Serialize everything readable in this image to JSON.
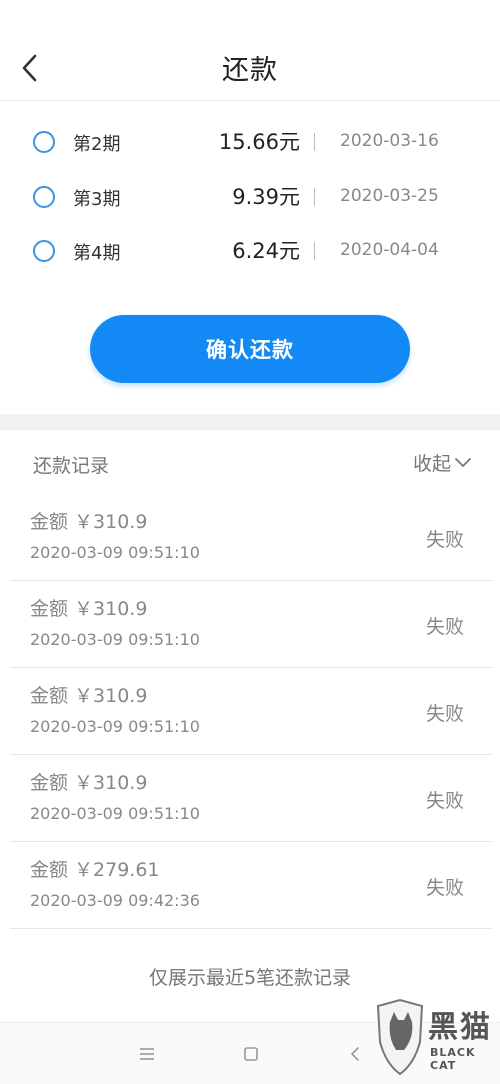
{
  "header": {
    "title": "还款"
  },
  "periods": [
    {
      "label": "第2期",
      "amount": "15.66元",
      "date": "2020-03-16"
    },
    {
      "label": "第3期",
      "amount": "9.39元",
      "date": "2020-03-25"
    },
    {
      "label": "第4期",
      "amount": "6.24元",
      "date": "2020-04-04"
    }
  ],
  "confirm_label": "确认还款",
  "records": {
    "title": "还款记录",
    "toggle_label": "收起",
    "items": [
      {
        "amount": "金额 ￥310.9",
        "time": "2020-03-09 09:51:10",
        "status": "失败"
      },
      {
        "amount": "金额 ￥310.9",
        "time": "2020-03-09 09:51:10",
        "status": "失败"
      },
      {
        "amount": "金额 ￥310.9",
        "time": "2020-03-09 09:51:10",
        "status": "失败"
      },
      {
        "amount": "金额 ￥310.9",
        "time": "2020-03-09 09:51:10",
        "status": "失败"
      },
      {
        "amount": "金额 ￥279.61",
        "time": "2020-03-09 09:42:36",
        "status": "失败"
      }
    ],
    "footer": "仅展示最近5笔还款记录"
  },
  "navbar": {
    "icons": [
      "menu-icon",
      "home-icon",
      "back-icon"
    ]
  },
  "watermark": {
    "name_cn": "黑猫",
    "name_en": "BLACK CAT"
  },
  "colors": {
    "accent": "#1289f5",
    "radio": "#3a94e4",
    "muted_text": "#888888"
  }
}
